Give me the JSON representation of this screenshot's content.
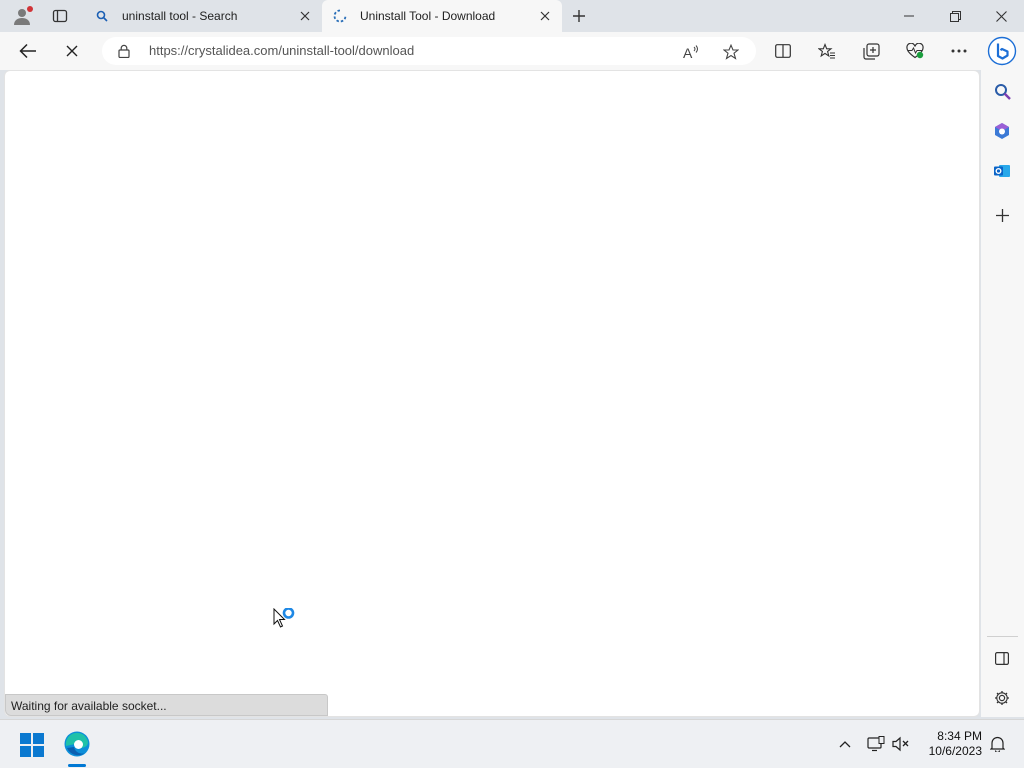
{
  "tabs": [
    {
      "title": "uninstall tool - Search",
      "favicon": "search-icon",
      "active": false
    },
    {
      "title": "Uninstall Tool - Download",
      "favicon": "loading-spinner-icon",
      "active": true
    }
  ],
  "address": {
    "url": "https://crystalidea.com/uninstall-tool/download"
  },
  "status_text": "Waiting for available socket...",
  "clock": {
    "time": "8:34 PM",
    "date": "10/6/2023"
  },
  "colors": {
    "accent": "#0078d4",
    "tabstrip": "#dfe3e8",
    "toolbar": "#f7f7f7"
  }
}
